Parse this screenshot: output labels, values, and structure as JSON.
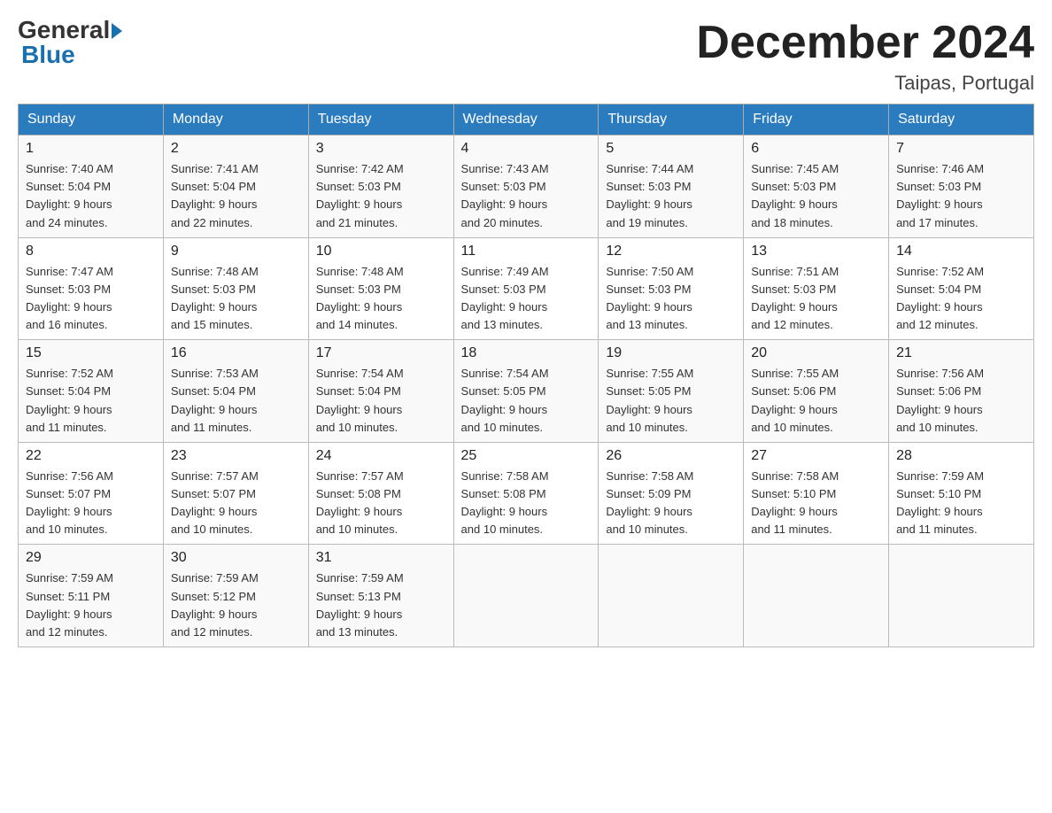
{
  "header": {
    "logo_general": "General",
    "logo_blue": "Blue",
    "title": "December 2024",
    "location": "Taipas, Portugal"
  },
  "days_of_week": [
    "Sunday",
    "Monday",
    "Tuesday",
    "Wednesday",
    "Thursday",
    "Friday",
    "Saturday"
  ],
  "weeks": [
    [
      {
        "day": "1",
        "sunrise": "7:40 AM",
        "sunset": "5:04 PM",
        "daylight": "9 hours and 24 minutes."
      },
      {
        "day": "2",
        "sunrise": "7:41 AM",
        "sunset": "5:04 PM",
        "daylight": "9 hours and 22 minutes."
      },
      {
        "day": "3",
        "sunrise": "7:42 AM",
        "sunset": "5:03 PM",
        "daylight": "9 hours and 21 minutes."
      },
      {
        "day": "4",
        "sunrise": "7:43 AM",
        "sunset": "5:03 PM",
        "daylight": "9 hours and 20 minutes."
      },
      {
        "day": "5",
        "sunrise": "7:44 AM",
        "sunset": "5:03 PM",
        "daylight": "9 hours and 19 minutes."
      },
      {
        "day": "6",
        "sunrise": "7:45 AM",
        "sunset": "5:03 PM",
        "daylight": "9 hours and 18 minutes."
      },
      {
        "day": "7",
        "sunrise": "7:46 AM",
        "sunset": "5:03 PM",
        "daylight": "9 hours and 17 minutes."
      }
    ],
    [
      {
        "day": "8",
        "sunrise": "7:47 AM",
        "sunset": "5:03 PM",
        "daylight": "9 hours and 16 minutes."
      },
      {
        "day": "9",
        "sunrise": "7:48 AM",
        "sunset": "5:03 PM",
        "daylight": "9 hours and 15 minutes."
      },
      {
        "day": "10",
        "sunrise": "7:48 AM",
        "sunset": "5:03 PM",
        "daylight": "9 hours and 14 minutes."
      },
      {
        "day": "11",
        "sunrise": "7:49 AM",
        "sunset": "5:03 PM",
        "daylight": "9 hours and 13 minutes."
      },
      {
        "day": "12",
        "sunrise": "7:50 AM",
        "sunset": "5:03 PM",
        "daylight": "9 hours and 13 minutes."
      },
      {
        "day": "13",
        "sunrise": "7:51 AM",
        "sunset": "5:03 PM",
        "daylight": "9 hours and 12 minutes."
      },
      {
        "day": "14",
        "sunrise": "7:52 AM",
        "sunset": "5:04 PM",
        "daylight": "9 hours and 12 minutes."
      }
    ],
    [
      {
        "day": "15",
        "sunrise": "7:52 AM",
        "sunset": "5:04 PM",
        "daylight": "9 hours and 11 minutes."
      },
      {
        "day": "16",
        "sunrise": "7:53 AM",
        "sunset": "5:04 PM",
        "daylight": "9 hours and 11 minutes."
      },
      {
        "day": "17",
        "sunrise": "7:54 AM",
        "sunset": "5:04 PM",
        "daylight": "9 hours and 10 minutes."
      },
      {
        "day": "18",
        "sunrise": "7:54 AM",
        "sunset": "5:05 PM",
        "daylight": "9 hours and 10 minutes."
      },
      {
        "day": "19",
        "sunrise": "7:55 AM",
        "sunset": "5:05 PM",
        "daylight": "9 hours and 10 minutes."
      },
      {
        "day": "20",
        "sunrise": "7:55 AM",
        "sunset": "5:06 PM",
        "daylight": "9 hours and 10 minutes."
      },
      {
        "day": "21",
        "sunrise": "7:56 AM",
        "sunset": "5:06 PM",
        "daylight": "9 hours and 10 minutes."
      }
    ],
    [
      {
        "day": "22",
        "sunrise": "7:56 AM",
        "sunset": "5:07 PM",
        "daylight": "9 hours and 10 minutes."
      },
      {
        "day": "23",
        "sunrise": "7:57 AM",
        "sunset": "5:07 PM",
        "daylight": "9 hours and 10 minutes."
      },
      {
        "day": "24",
        "sunrise": "7:57 AM",
        "sunset": "5:08 PM",
        "daylight": "9 hours and 10 minutes."
      },
      {
        "day": "25",
        "sunrise": "7:58 AM",
        "sunset": "5:08 PM",
        "daylight": "9 hours and 10 minutes."
      },
      {
        "day": "26",
        "sunrise": "7:58 AM",
        "sunset": "5:09 PM",
        "daylight": "9 hours and 10 minutes."
      },
      {
        "day": "27",
        "sunrise": "7:58 AM",
        "sunset": "5:10 PM",
        "daylight": "9 hours and 11 minutes."
      },
      {
        "day": "28",
        "sunrise": "7:59 AM",
        "sunset": "5:10 PM",
        "daylight": "9 hours and 11 minutes."
      }
    ],
    [
      {
        "day": "29",
        "sunrise": "7:59 AM",
        "sunset": "5:11 PM",
        "daylight": "9 hours and 12 minutes."
      },
      {
        "day": "30",
        "sunrise": "7:59 AM",
        "sunset": "5:12 PM",
        "daylight": "9 hours and 12 minutes."
      },
      {
        "day": "31",
        "sunrise": "7:59 AM",
        "sunset": "5:13 PM",
        "daylight": "9 hours and 13 minutes."
      },
      null,
      null,
      null,
      null
    ]
  ],
  "labels": {
    "sunrise": "Sunrise:",
    "sunset": "Sunset:",
    "daylight": "Daylight:"
  }
}
